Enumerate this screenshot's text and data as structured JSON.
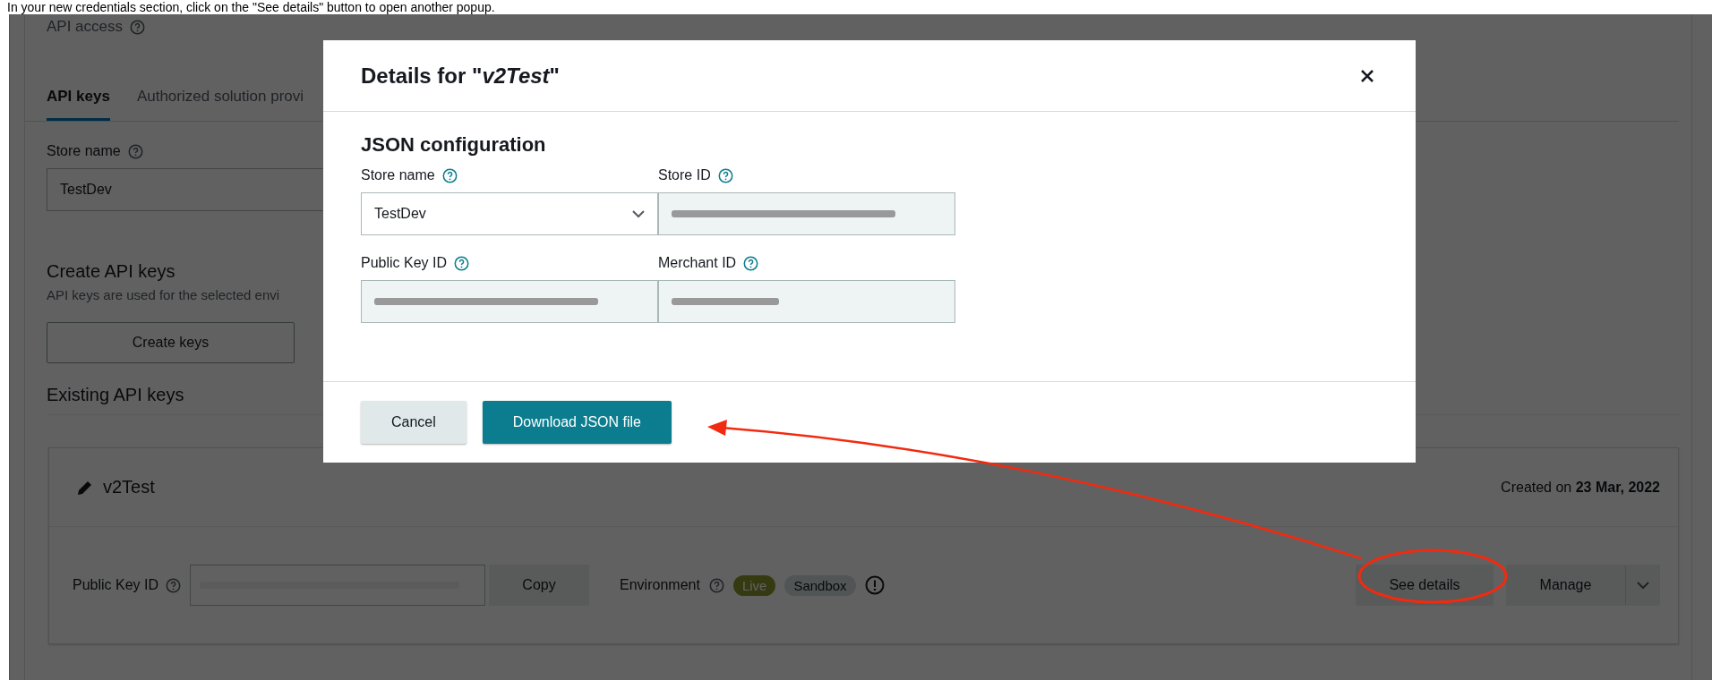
{
  "instruction": "In your new credentials section, click on the \"See details\" button to open another popup.",
  "page": {
    "section_title": "API access",
    "tabs": [
      {
        "label": "API keys",
        "selected": true
      },
      {
        "label": "Authorized solution provi",
        "selected": false
      }
    ],
    "store_field": {
      "label": "Store name",
      "value": "TestDev"
    },
    "create": {
      "title": "Create API keys",
      "description": "API keys are used for the selected envi",
      "button": "Create keys"
    },
    "existing": {
      "title": "Existing API keys",
      "key_card": {
        "name": "v2Test",
        "created": "Created on **23 Mar, 2022**",
        "public_key_label": "Public Key ID",
        "copy_button": "Copy",
        "environment_label": "Environment",
        "environments": [
          {
            "label": "Live",
            "selected": true
          },
          {
            "label": "Sandbox",
            "selected": false
          }
        ],
        "see_details_button": "See details",
        "manage_button": "Manage"
      }
    }
  },
  "modal": {
    "title": "Details for \"*v2Test*\"",
    "section_title": "JSON configuration",
    "fields": [
      {
        "label": "Store name",
        "kind": "select",
        "value": "TestDev"
      },
      {
        "label": "Store ID",
        "kind": "redacted"
      },
      {
        "label": "Public Key ID",
        "kind": "redacted"
      },
      {
        "label": "Merchant ID",
        "kind": "redacted"
      }
    ],
    "buttons": [
      {
        "label": "Cancel",
        "kind": "secondary"
      },
      {
        "label": "Download JSON file",
        "kind": "primary"
      }
    ]
  }
}
